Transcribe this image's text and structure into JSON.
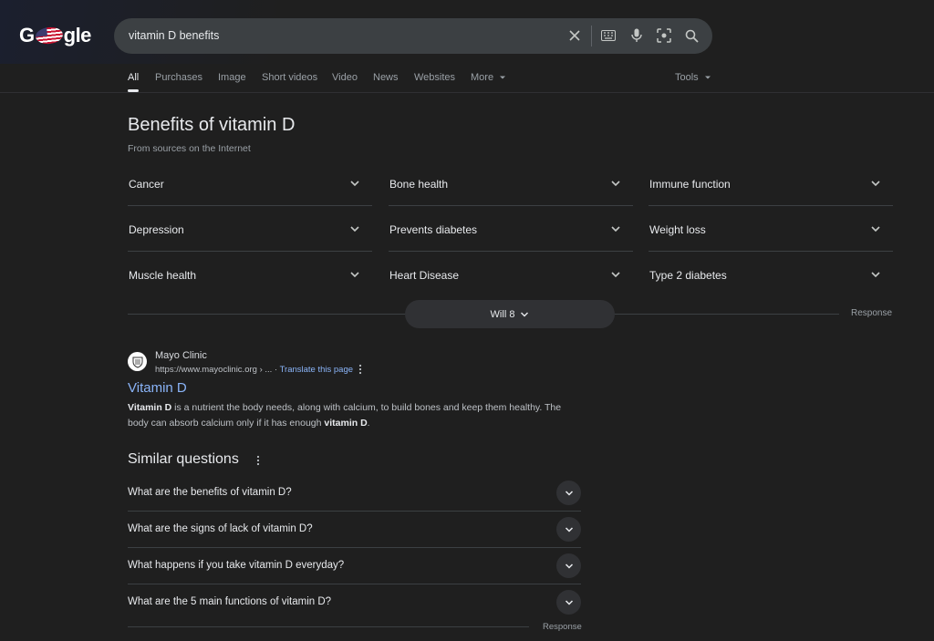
{
  "logo": {
    "text_left": "G",
    "text_right": "gle"
  },
  "search": {
    "query": "vitamin D benefits"
  },
  "tabs": [
    {
      "label": "All",
      "active": true
    },
    {
      "label": "Purchases"
    },
    {
      "label": "Image"
    },
    {
      "label": "Short videos"
    },
    {
      "label": "Video"
    },
    {
      "label": "News"
    },
    {
      "label": "Websites"
    },
    {
      "label": "More"
    }
  ],
  "tools_label": "Tools",
  "benefits": {
    "title": "Benefits of vitamin D",
    "subtitle": "From sources on the Internet",
    "items": [
      "Cancer",
      "Bone health",
      "Immune function",
      "Depression",
      "Prevents diabetes",
      "Weight loss",
      "Muscle health",
      "Heart Disease",
      "Type 2 diabetes"
    ],
    "more_label": "Will 8",
    "response_label": "Response"
  },
  "result": {
    "site_name": "Mayo Clinic",
    "url": "https://www.mayoclinic.org › ...",
    "separator": " · ",
    "translate_label": "Translate this page",
    "title": "Vitamin D",
    "snippet_b1": "Vitamin D",
    "snippet_t1": " is a nutrient the body needs, along with calcium, to build bones and keep them healthy. The body can absorb calcium only if it has enough ",
    "snippet_b2": "vitamin D",
    "snippet_t2": "."
  },
  "similar": {
    "title": "Similar questions",
    "questions": [
      "What are the benefits of vitamin D?",
      "What are the signs of lack of vitamin D?",
      "What happens if you take vitamin D everyday?",
      "What are the 5 main functions of vitamin D?"
    ],
    "response_label": "Response"
  },
  "icons": {
    "clear": "close-icon",
    "keyboard": "keyboard-icon",
    "voice": "microphone-icon",
    "lens": "camera-lens-icon",
    "search": "search-icon",
    "chevron": "chevron-down-icon",
    "more": "more-vert-icon"
  }
}
